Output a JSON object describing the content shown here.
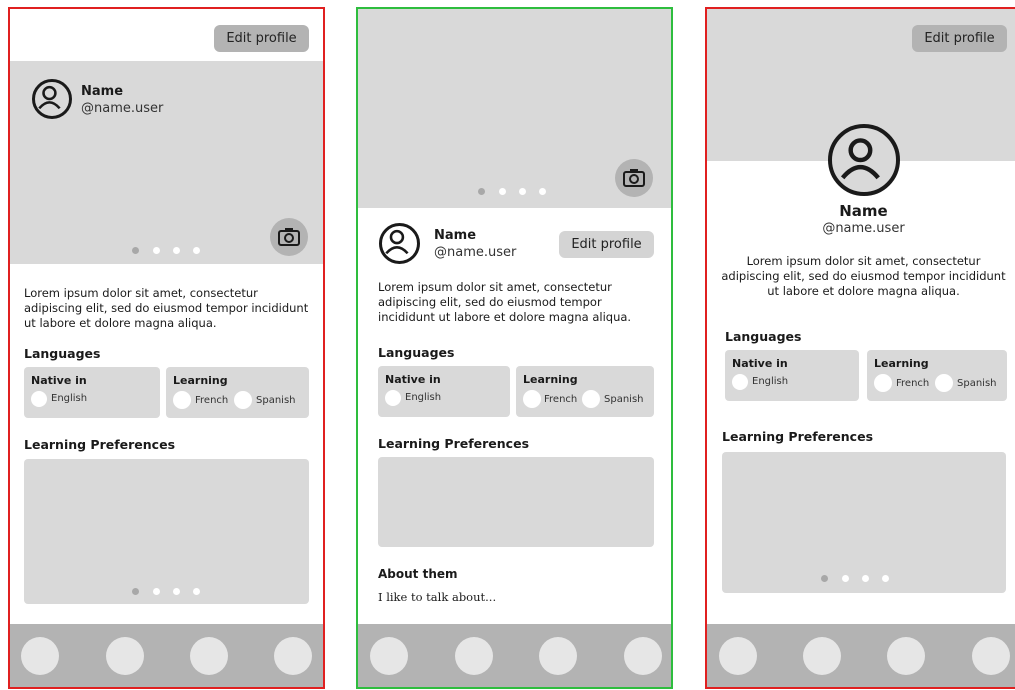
{
  "frame1": {
    "edit_label": "Edit profile",
    "name": "Name",
    "handle": "@name.user",
    "bio": "Lorem ipsum dolor sit amet, consectetur adipiscing elit, sed do eiusmod tempor incididunt ut labore et dolore magna aliqua.",
    "languages_heading": "Languages",
    "native_title": "Native in",
    "native_lang": "English",
    "learning_title": "Learning",
    "learning_lang_1": "French",
    "learning_lang_2": "Spanish",
    "prefs_heading": "Learning Preferences"
  },
  "frame2": {
    "edit_label": "Edit profile",
    "name": "Name",
    "handle": "@name.user",
    "bio": "Lorem ipsum dolor sit amet, consectetur adipiscing elit, sed do eiusmod tempor incididunt ut labore et dolore magna aliqua.",
    "languages_heading": "Languages",
    "native_title": "Native in",
    "native_lang": "English",
    "learning_title": "Learning",
    "learning_lang_1": "French",
    "learning_lang_2": "Spanish",
    "prefs_heading": "Learning Preferences",
    "about_heading": "About them",
    "about_text": "I like to talk about..."
  },
  "frame3": {
    "edit_label": "Edit profile",
    "name": "Name",
    "handle": "@name.user",
    "bio": "Lorem ipsum dolor sit amet, consectetur adipiscing elit, sed do eiusmod tempor incididunt ut labore et dolore magna aliqua.",
    "languages_heading": "Languages",
    "native_title": "Native in",
    "native_lang": "English",
    "learning_title": "Learning",
    "learning_lang_1": "French",
    "learning_lang_2": "Spanish",
    "prefs_heading": "Learning Preferences"
  },
  "icons": {
    "avatar": "user-circle-icon",
    "camera": "camera-icon",
    "nav": "nav-circle-icon"
  },
  "colors": {
    "frame_red": "#e02020",
    "frame_green": "#2ebd3e",
    "placeholder_gray": "#d9d9d9",
    "button_gray": "#b3b3b3"
  }
}
